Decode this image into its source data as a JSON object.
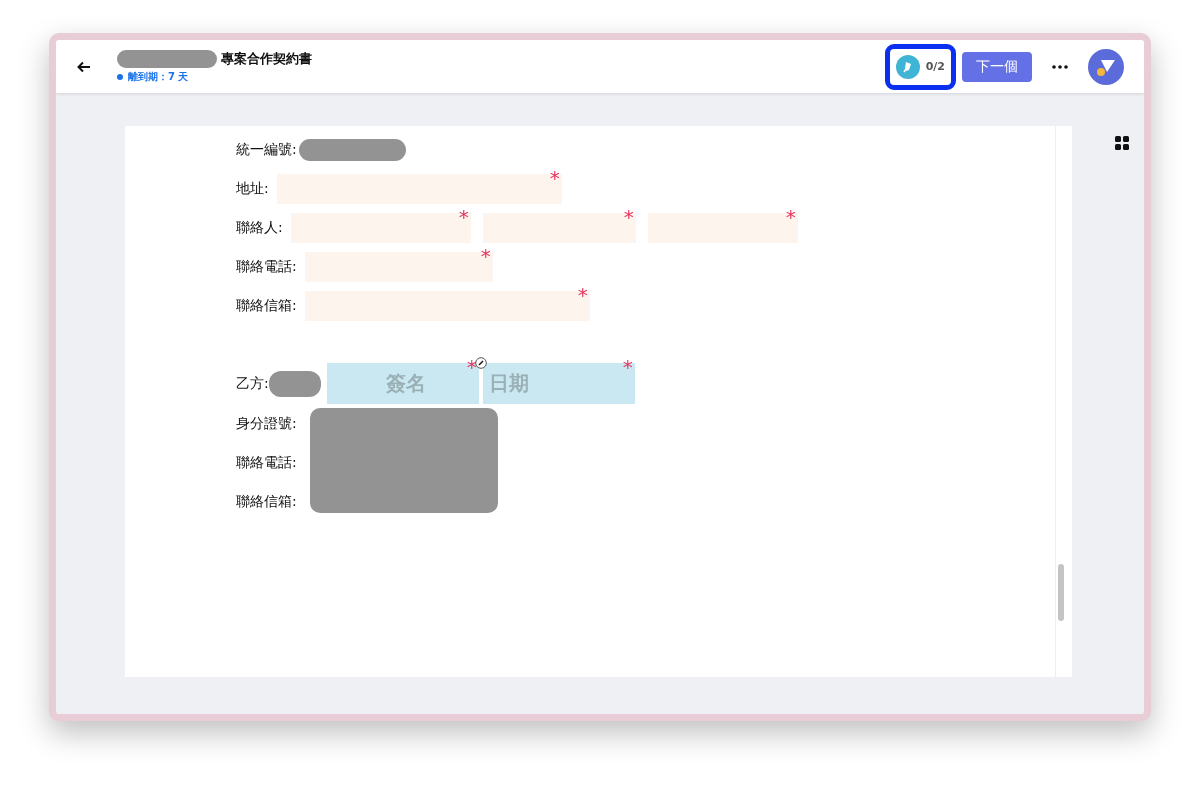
{
  "header": {
    "title": "專案合作契約書",
    "deadline": "離到期：7 天",
    "signature_count": "0/2",
    "next_button": "下一個"
  },
  "form": {
    "rows": [
      {
        "kind": "redacted",
        "label": "統一編號:"
      },
      {
        "kind": "inputs",
        "label": "地址:",
        "inputs": [
          {
            "required_mark": "*"
          }
        ]
      },
      {
        "kind": "inputs",
        "label": "聯絡人:",
        "inputs": [
          {
            "required_mark": "*"
          },
          {
            "required_mark": "*"
          },
          {
            "required_mark": "*"
          }
        ]
      },
      {
        "kind": "inputs",
        "label": "聯絡電話:",
        "inputs": [
          {
            "required_mark": "*"
          }
        ]
      },
      {
        "kind": "inputs",
        "label": "聯絡信箱:",
        "inputs": [
          {
            "required_mark": "*"
          }
        ]
      },
      {
        "kind": "signature",
        "label": "乙方:",
        "inputs": [
          {
            "placeholder": "簽名",
            "required_mark": "*"
          },
          {
            "placeholder": "日期",
            "required_mark": "*"
          }
        ]
      },
      {
        "kind": "covered",
        "label": "身分證號:"
      },
      {
        "kind": "covered",
        "label": "聯絡電話:"
      },
      {
        "kind": "covered",
        "label": "聯絡信箱:"
      }
    ]
  }
}
